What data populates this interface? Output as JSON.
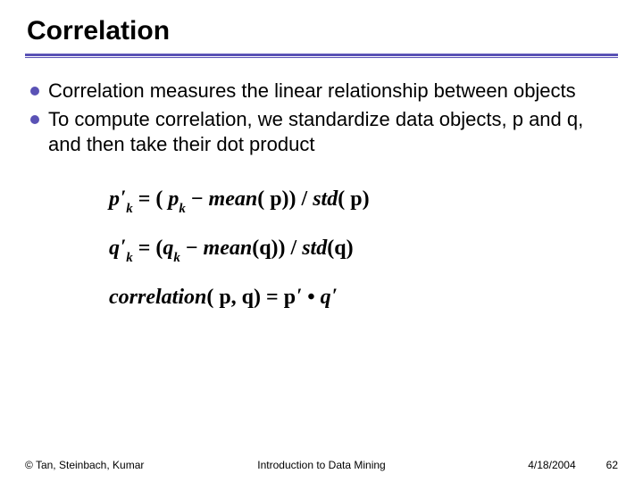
{
  "title": "Correlation",
  "bullets": [
    "Correlation measures the linear relationship between objects",
    "To compute correlation, we standardize data objects, p and q, and then take their dot product"
  ],
  "equations": {
    "eq1": {
      "lhs_var": "p",
      "lhs_prime": "′",
      "lhs_sub": "k",
      "eq": " = ( ",
      "r_var": "p",
      "r_sub": "k",
      "minus": " − ",
      "mean": "mean",
      "mean_arg": "( p)) / ",
      "std": "std",
      "std_arg": "( p)"
    },
    "eq2": {
      "lhs_var": "q",
      "lhs_prime": "′",
      "lhs_sub": "k",
      "eq": " = (",
      "r_var": "q",
      "r_sub": "k",
      "minus": " − ",
      "mean": "mean",
      "mean_arg": "(q)) / ",
      "std": "std",
      "std_arg": "(q)"
    },
    "eq3": {
      "fn": "correlation",
      "args": "( p, q) = p",
      "p1": "′",
      "dot": " • ",
      "q": "q",
      "p2": "′"
    }
  },
  "footer": {
    "left": "© Tan, Steinbach, Kumar",
    "center": "Introduction to Data Mining",
    "date": "4/18/2004",
    "page": "62"
  }
}
